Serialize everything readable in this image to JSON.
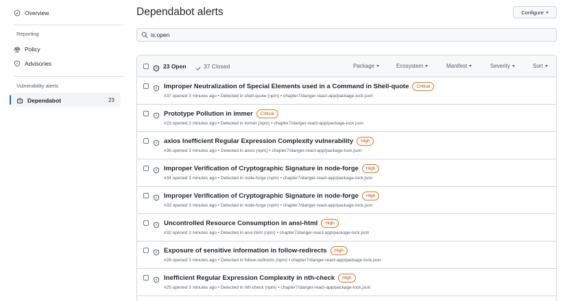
{
  "sidebar": {
    "overview_label": "Overview",
    "reporting_heading": "Reporting",
    "policy_label": "Policy",
    "advisories_label": "Advisories",
    "vuln_heading": "Vulnerability alerts",
    "dependabot_label": "Dependabot",
    "dependabot_count": "23"
  },
  "header": {
    "title": "Dependabot alerts",
    "configure_label": "Configure"
  },
  "search": {
    "value": "is:open"
  },
  "list_header": {
    "open_label": "23 Open",
    "closed_label": "37 Closed",
    "filters": [
      "Package",
      "Ecosystem",
      "Manifest",
      "Severity",
      "Sort"
    ]
  },
  "alerts": [
    {
      "title": "Improper Neutralization of Special Elements used in a Command in Shell-quote",
      "severity": "Critical",
      "meta": "#37 opened 3 minutes ago • Detected in shell-quote (npm) • chapter7/danger-react-app/package-lock.json"
    },
    {
      "title": "Prototype Pollution in immer",
      "severity": "Critical",
      "meta": "#23 opened 3 minutes ago • Detected in immer (npm) • chapter7/danger-react-app/package-lock.json"
    },
    {
      "title": "axios Inefficient Regular Expression Complexity vulnerability",
      "severity": "High",
      "meta": "#36 opened 3 minutes ago • Detected in axios (npm) • chapter7/danger-react-app/package-lock.json"
    },
    {
      "title": "Improper Verification of Cryptographic Signature in node-forge",
      "severity": "High",
      "meta": "#34 opened 3 minutes ago • Detected in node-forge (npm) • chapter7/danger-react-app/package-lock.json"
    },
    {
      "title": "Improper Verification of Cryptographic Signature in node-forge",
      "severity": "High",
      "meta": "#33 opened 3 minutes ago • Detected in node-forge (npm) • chapter7/danger-react-app/package-lock.json"
    },
    {
      "title": "Uncontrolled Resource Consumption in ansi-html",
      "severity": "High",
      "meta": "#32 opened 3 minutes ago • Detected in ansi-html (npm) • chapter7/danger-react-app/package-lock.json"
    },
    {
      "title": "Exposure of sensitive information in follow-redirects",
      "severity": "High",
      "meta": "#28 opened 3 minutes ago • Detected in follow-redirects (npm) • chapter7/danger-react-app/package-lock.json"
    },
    {
      "title": "Inefficient Regular Expression Complexity in nth-check",
      "severity": "High",
      "meta": "#25 opened 3 minutes ago • Detected in nth-check (npm) • chapter7/danger-react-app/package-lock.json"
    }
  ],
  "icons": {
    "overview": "clock-check-icon",
    "policy": "law-icon",
    "advisories": "shield-icon",
    "dependabot": "bot-icon",
    "search": "search-icon",
    "alert": "shield-alert-icon",
    "closed": "check-icon"
  },
  "colors": {
    "accent": "#0969da",
    "severity_border": "#e16f24",
    "severity_text": "#bc4c00"
  }
}
